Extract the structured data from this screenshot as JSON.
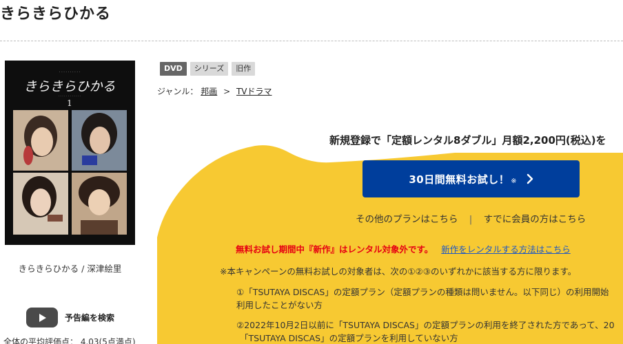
{
  "page": {
    "title": "きらきらひかる"
  },
  "cover": {
    "alt": "きらきらひかる",
    "title_art": "きらきらひかる",
    "volume": "1",
    "caption": "きらきらひかる / 深津絵里"
  },
  "trailer": {
    "label": "予告編を検索",
    "icon": "play-icon"
  },
  "rating": {
    "text": "全体の平均評価点： 4.03(5点満点)"
  },
  "tags": [
    "DVD",
    "シリーズ",
    "旧作"
  ],
  "genre": {
    "prefix": "ジャンル：",
    "items": [
      "邦画",
      "TVドラマ"
    ],
    "separator": ">"
  },
  "promo": {
    "headline": "新規登録で「定額レンタル8ダブル」月額2,200円(税込)を",
    "cta_label": "30日間無料お試し！",
    "cta_mark": "※",
    "cta_icon": "chevron-right-icon",
    "other_plans": "その他のプランはこちら",
    "separator": "|",
    "member_link": "すでに会員の方はこちら",
    "notice_red": "無料お試し期間中『新作』はレンタル対象外です。",
    "notice_link": "新作をレンタルする方法はこちら",
    "note_intro": "※本キャンペーンの無料お試しの対象者は、次の①②③のいずれかに該当する方に限ります。",
    "note1_line1": "①「TSUTAYA DISCAS」の定額プラン（定額プランの種類は問いません。以下同じ）の利用開始",
    "note1_line2": "利用したことがない方",
    "note2_line1": "②2022年10月2日以前に「TSUTAYA DISCAS」の定額プランの利用を終了された方であって、20",
    "note2_line2": "「TSUTAYA DISCAS」の定額プランを利用していない方"
  },
  "colors": {
    "accent_blue": "#003e9c",
    "promo_yellow": "#f7c932",
    "notice_red": "#e60012",
    "link_blue": "#1a56c8"
  }
}
